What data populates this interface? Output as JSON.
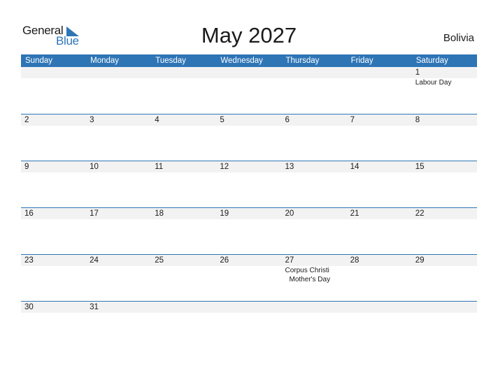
{
  "logo": {
    "general": "General",
    "blue": "Blue"
  },
  "header": {
    "title": "May 2027",
    "country": "Bolivia"
  },
  "weekdays": [
    "Sunday",
    "Monday",
    "Tuesday",
    "Wednesday",
    "Thursday",
    "Friday",
    "Saturday"
  ],
  "weeks": [
    [
      {
        "day": "",
        "events": []
      },
      {
        "day": "",
        "events": []
      },
      {
        "day": "",
        "events": []
      },
      {
        "day": "",
        "events": []
      },
      {
        "day": "",
        "events": []
      },
      {
        "day": "",
        "events": []
      },
      {
        "day": "1",
        "events": [
          "Labour Day"
        ]
      }
    ],
    [
      {
        "day": "2",
        "events": []
      },
      {
        "day": "3",
        "events": []
      },
      {
        "day": "4",
        "events": []
      },
      {
        "day": "5",
        "events": []
      },
      {
        "day": "6",
        "events": []
      },
      {
        "day": "7",
        "events": []
      },
      {
        "day": "8",
        "events": []
      }
    ],
    [
      {
        "day": "9",
        "events": []
      },
      {
        "day": "10",
        "events": []
      },
      {
        "day": "11",
        "events": []
      },
      {
        "day": "12",
        "events": []
      },
      {
        "day": "13",
        "events": []
      },
      {
        "day": "14",
        "events": []
      },
      {
        "day": "15",
        "events": []
      }
    ],
    [
      {
        "day": "16",
        "events": []
      },
      {
        "day": "17",
        "events": []
      },
      {
        "day": "18",
        "events": []
      },
      {
        "day": "19",
        "events": []
      },
      {
        "day": "20",
        "events": []
      },
      {
        "day": "21",
        "events": []
      },
      {
        "day": "22",
        "events": []
      }
    ],
    [
      {
        "day": "23",
        "events": []
      },
      {
        "day": "24",
        "events": []
      },
      {
        "day": "25",
        "events": []
      },
      {
        "day": "26",
        "events": []
      },
      {
        "day": "27",
        "events": [
          "Corpus Christi",
          "Mother's Day"
        ]
      },
      {
        "day": "28",
        "events": []
      },
      {
        "day": "29",
        "events": []
      }
    ],
    [
      {
        "day": "30",
        "events": []
      },
      {
        "day": "31",
        "events": []
      },
      {
        "day": "",
        "events": []
      },
      {
        "day": "",
        "events": []
      },
      {
        "day": "",
        "events": []
      },
      {
        "day": "",
        "events": []
      },
      {
        "day": "",
        "events": []
      }
    ]
  ],
  "colors": {
    "accent": "#2e75b6",
    "band": "#f2f2f2"
  }
}
